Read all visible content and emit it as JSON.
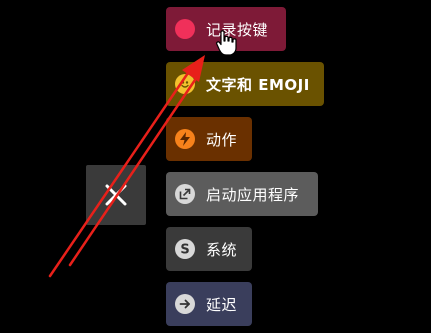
{
  "close_button": {
    "icon": "close-icon"
  },
  "menu": {
    "items": [
      {
        "id": "record",
        "label": "记录按键",
        "icon": "record-dot-icon",
        "bg": "#7e1a37",
        "icon_bg": "#f0305a"
      },
      {
        "id": "text",
        "label": "文字和 EMOJI",
        "icon": "emoji-icon",
        "bg": "#6a5200",
        "icon_bg": "#f2c12e"
      },
      {
        "id": "action",
        "label": "动作",
        "icon": "lightning-icon",
        "bg": "#6a3000",
        "icon_bg": "#f7821b"
      },
      {
        "id": "launch",
        "label": "启动应用程序",
        "icon": "launch-app-icon",
        "bg": "#5c5c5c",
        "icon_bg": "#d8d8d8"
      },
      {
        "id": "system",
        "label": "系统",
        "icon": "system-s-icon",
        "bg": "#3a3a3a",
        "icon_bg": "#d8d8d8"
      },
      {
        "id": "delay",
        "label": "延迟",
        "icon": "arrow-right-icon",
        "bg": "#3a3e5c",
        "icon_bg": "#d8d8d8"
      }
    ]
  },
  "annotation": {
    "arrow_color": "#e8201a"
  },
  "cursor": {
    "icon": "hand-pointer-icon"
  }
}
